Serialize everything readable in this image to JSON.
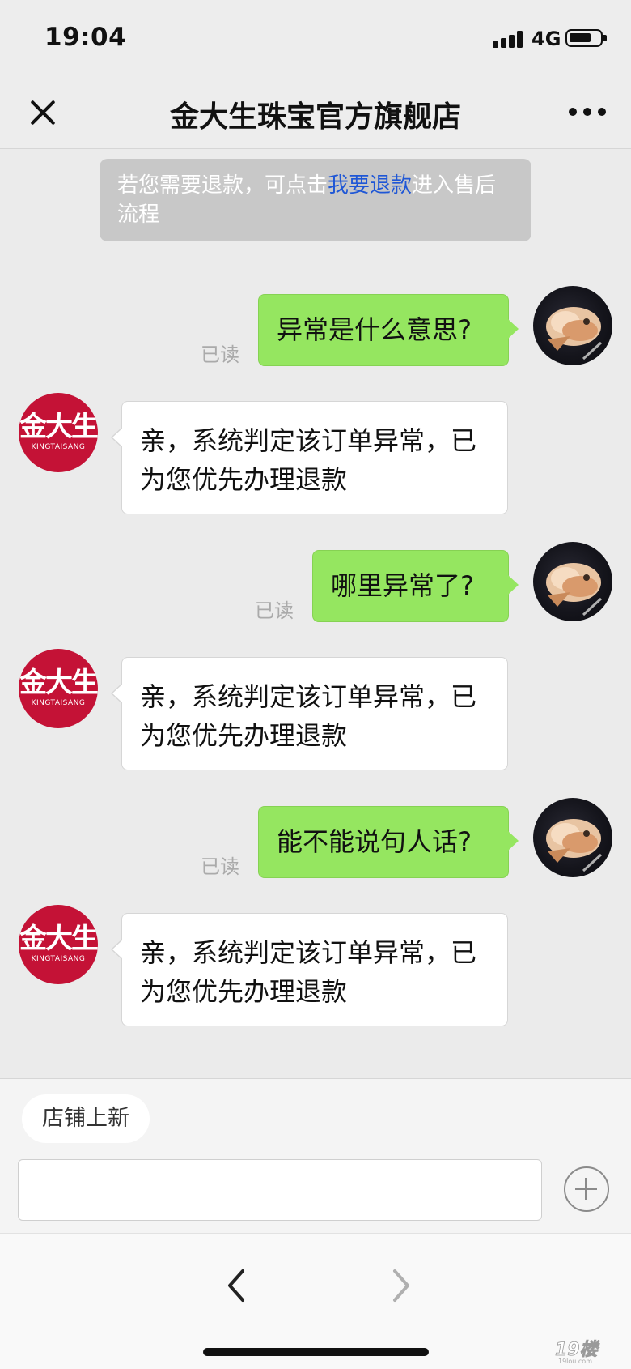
{
  "status_bar": {
    "time": "19:04",
    "network": "4G"
  },
  "header": {
    "title": "金大生珠宝官方旗舰店"
  },
  "notice": {
    "text_before": "若您需要退款，可点击",
    "link_text": "我要退款",
    "text_after": "进入售后流程"
  },
  "shop": {
    "logo_cn": "金大生",
    "logo_en": "KINGTAISANG"
  },
  "messages": [
    {
      "side": "out",
      "text": "异常是什么意思?",
      "status": "已读"
    },
    {
      "side": "in",
      "text": "亲，系统判定该订单异常，已为您优先办理退款"
    },
    {
      "side": "out",
      "text": "哪里异常了?",
      "status": "已读"
    },
    {
      "side": "in",
      "text": "亲，系统判定该订单异常，已为您优先办理退款"
    },
    {
      "side": "out",
      "text": "能不能说句人话?",
      "status": "已读"
    },
    {
      "side": "in",
      "text": "亲，系统判定该订单异常，已为您优先办理退款"
    }
  ],
  "input_area": {
    "quick_reply": "店铺上新",
    "input_value": ""
  },
  "watermark": {
    "text": "19楼",
    "sub": "19lou.com"
  },
  "icons": {
    "close": "close-icon",
    "more": "more-icon",
    "add": "plus-circle-icon",
    "back": "chevron-left-icon",
    "forward": "chevron-right-icon"
  },
  "colors": {
    "outgoing_bubble": "#95e660",
    "incoming_bubble": "#ffffff",
    "link": "#1f57d6",
    "shop_brand": "#c41236",
    "background": "#ebebeb"
  }
}
